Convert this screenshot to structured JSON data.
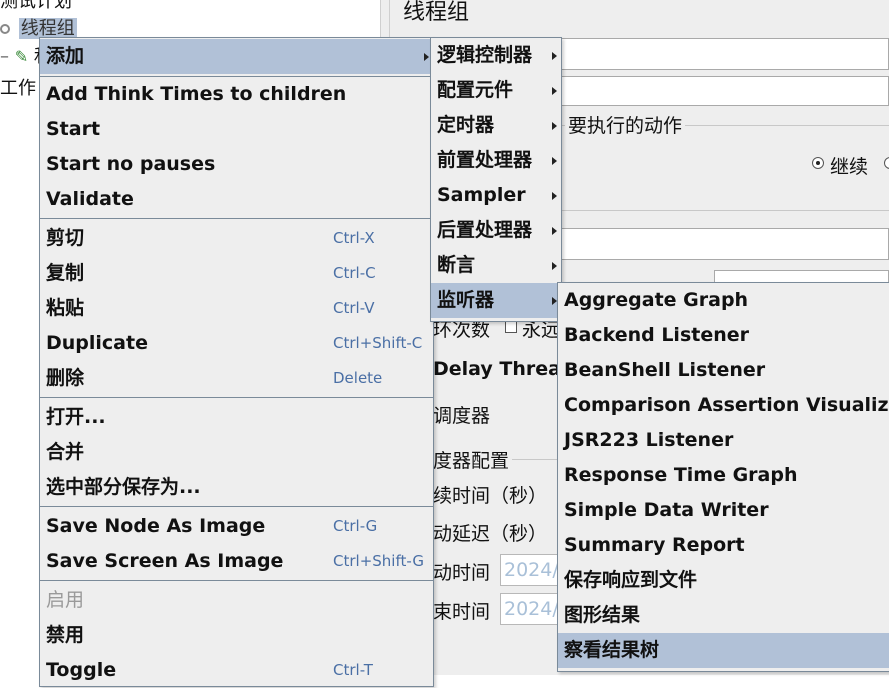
{
  "tree": {
    "test_plan": "测试计划",
    "thread_group": "线程组",
    "sampler_prefix": "和",
    "workbench": "工作"
  },
  "panel": {
    "title": "线程组",
    "action_title": "要执行的动作",
    "continue_label": "继续",
    "loop_label": "环次数",
    "forever_label": "永远",
    "delay_thread": "Delay Thread",
    "scheduler": "调度器",
    "scheduler_config": "度器配置",
    "duration": "续时间（秒）",
    "startup_delay": "动延迟（秒）",
    "start_time": "动时间",
    "end_time": "束时间",
    "start_time_value": "2024/",
    "end_time_value": "2024/"
  },
  "context_menu": {
    "items": [
      {
        "label": "添加"
      },
      {
        "label": "Add Think Times to children"
      },
      {
        "label": "Start"
      },
      {
        "label": "Start no pauses"
      },
      {
        "label": "Validate"
      },
      {
        "label": "剪切",
        "shortcut": "Ctrl-X"
      },
      {
        "label": "复制",
        "shortcut": "Ctrl-C"
      },
      {
        "label": "粘贴",
        "shortcut": "Ctrl-V"
      },
      {
        "label": "Duplicate",
        "shortcut": "Ctrl+Shift-C"
      },
      {
        "label": "删除",
        "shortcut": "Delete"
      },
      {
        "label": "打开..."
      },
      {
        "label": "合并"
      },
      {
        "label": "选中部分保存为..."
      },
      {
        "label": "Save Node As Image",
        "shortcut": "Ctrl-G"
      },
      {
        "label": "Save Screen As Image",
        "shortcut": "Ctrl+Shift-G"
      },
      {
        "label": "启用"
      },
      {
        "label": "禁用"
      },
      {
        "label": "Toggle",
        "shortcut": "Ctrl-T"
      }
    ]
  },
  "add_submenu": {
    "items": [
      {
        "label": "逻辑控制器"
      },
      {
        "label": "配置元件"
      },
      {
        "label": "定时器"
      },
      {
        "label": "前置处理器"
      },
      {
        "label": "Sampler"
      },
      {
        "label": "后置处理器"
      },
      {
        "label": "断言"
      },
      {
        "label": "监听器"
      }
    ]
  },
  "listener_submenu": {
    "items": [
      {
        "label": "Aggregate Graph"
      },
      {
        "label": "Backend Listener"
      },
      {
        "label": "BeanShell Listener"
      },
      {
        "label": "Comparison Assertion Visualizer"
      },
      {
        "label": "JSR223 Listener"
      },
      {
        "label": "Response Time Graph"
      },
      {
        "label": "Simple Data Writer"
      },
      {
        "label": "Summary Report"
      },
      {
        "label": "保存响应到文件"
      },
      {
        "label": "图形结果"
      },
      {
        "label": "察看结果树"
      }
    ]
  },
  "colors": {
    "menu_bg": "#eeeeee",
    "selection": "#b1c1d7",
    "shortcut_text": "#4a6fa5",
    "disabled_text": "#9a9a9a"
  }
}
